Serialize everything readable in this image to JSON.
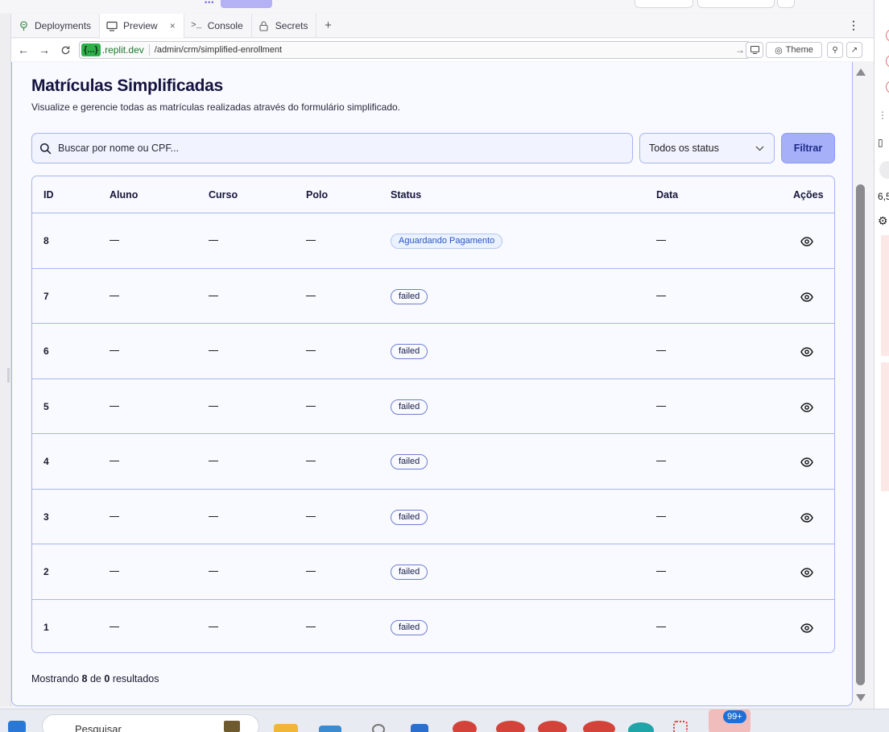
{
  "browser": {
    "tabs": [
      {
        "label": "Deployments",
        "icon": "deployments-icon"
      },
      {
        "label": "Preview",
        "icon": "preview-icon",
        "active": true,
        "close": "×"
      },
      {
        "label": "Console",
        "icon": "console-icon"
      },
      {
        "label": "Secrets",
        "icon": "lock-icon"
      }
    ],
    "add_tab": "+",
    "more": "⋮",
    "url": {
      "badge": "{...}",
      "domain": ".replit.dev",
      "path": "/admin/crm/simplified-enrollment"
    },
    "theme_label": "Theme"
  },
  "page": {
    "title": "Matrículas Simplificadas",
    "subtitle": "Visualize e gerencie todas as matrículas realizadas através do formulário simplificado.",
    "search_placeholder": "Buscar por nome ou CPF...",
    "status_filter": "Todos os status",
    "filter_button": "Filtrar"
  },
  "table": {
    "headers": {
      "id": "ID",
      "aluno": "Aluno",
      "curso": "Curso",
      "polo": "Polo",
      "status": "Status",
      "data": "Data",
      "acoes": "Ações"
    },
    "rows": [
      {
        "id": "8",
        "status": "Aguardando Pagamento"
      },
      {
        "id": "7",
        "status": "failed"
      },
      {
        "id": "6",
        "status": "failed"
      },
      {
        "id": "5",
        "status": "failed"
      },
      {
        "id": "4",
        "status": "failed"
      },
      {
        "id": "3",
        "status": "failed"
      },
      {
        "id": "2",
        "status": "failed"
      },
      {
        "id": "1",
        "status": "failed"
      }
    ]
  },
  "footer": {
    "prefix": "Mostrando",
    "shown": "8",
    "middle": "de",
    "total": "0",
    "suffix": "resultados"
  },
  "right_panel": {
    "number": "6,5"
  },
  "taskbar": {
    "search_text": "Pesquisar",
    "notification_count": "99+"
  },
  "colors": {
    "accent": "#a5b0f8",
    "border": "#a9b4ee",
    "title": "#14123e",
    "pending_badge": "#2757c4"
  }
}
